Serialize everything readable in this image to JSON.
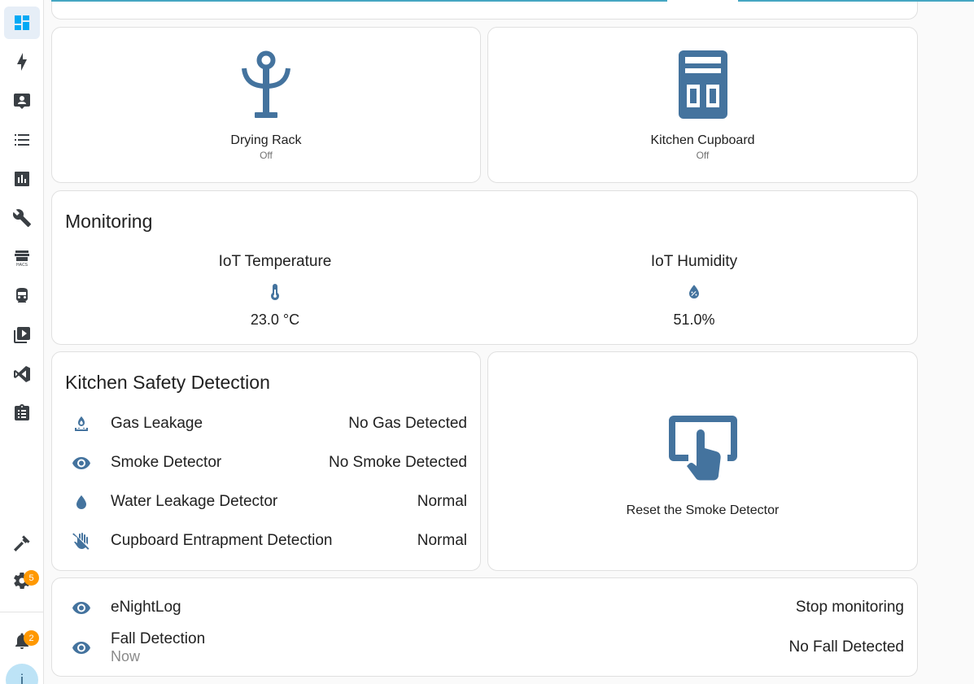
{
  "sidebar": {
    "items": [
      {
        "icon": "dashboard-icon",
        "active": true
      },
      {
        "icon": "energy-icon"
      },
      {
        "icon": "person-card-icon"
      },
      {
        "icon": "list-icon"
      },
      {
        "icon": "history-icon"
      },
      {
        "icon": "wrench-icon"
      },
      {
        "icon": "hacs-icon",
        "caption": "HACS"
      },
      {
        "icon": "train-icon"
      },
      {
        "icon": "media-icon"
      },
      {
        "icon": "vscode-icon"
      },
      {
        "icon": "clipboard-icon"
      }
    ],
    "developer_icon": "hammer-icon",
    "settings_badge": "5",
    "notifications_badge": "2",
    "avatar_initial": "i"
  },
  "buttons": [
    {
      "name": "Drying Rack",
      "state": "Off",
      "icon": "drying-rack-icon"
    },
    {
      "name": "Kitchen Cupboard",
      "state": "Off",
      "icon": "cupboard-icon"
    }
  ],
  "monitoring": {
    "title": "Monitoring",
    "entities": [
      {
        "name": "IoT Temperature",
        "value": "23.0 °C",
        "icon": "thermometer-icon"
      },
      {
        "name": "IoT Humidity",
        "value": "51.0%",
        "icon": "water-percent-icon"
      }
    ]
  },
  "safety": {
    "title": "Kitchen Safety Detection",
    "rows": [
      {
        "name": "Gas Leakage",
        "value": "No Gas Detected",
        "icon": "gas-burner-icon"
      },
      {
        "name": "Smoke Detector",
        "value": "No Smoke Detected",
        "icon": "eye-icon"
      },
      {
        "name": "Water Leakage Detector",
        "value": "Normal",
        "icon": "water-drop-icon"
      },
      {
        "name": "Cupboard Entrapment Detection",
        "value": "Normal",
        "icon": "hand-off-icon"
      }
    ]
  },
  "reset": {
    "name": "Reset the Smoke Detector",
    "icon": "touch-screen-icon"
  },
  "bottom": {
    "rows": [
      {
        "name": "eNightLog",
        "value": "Stop monitoring",
        "icon": "eye-icon"
      },
      {
        "name": "Fall Detection",
        "secondary": "Now",
        "value": "No Fall Detected",
        "icon": "eye-icon"
      }
    ]
  },
  "colors": {
    "icon": "#44739e",
    "accent": "#03a9f4",
    "badge": "#ff9800"
  }
}
